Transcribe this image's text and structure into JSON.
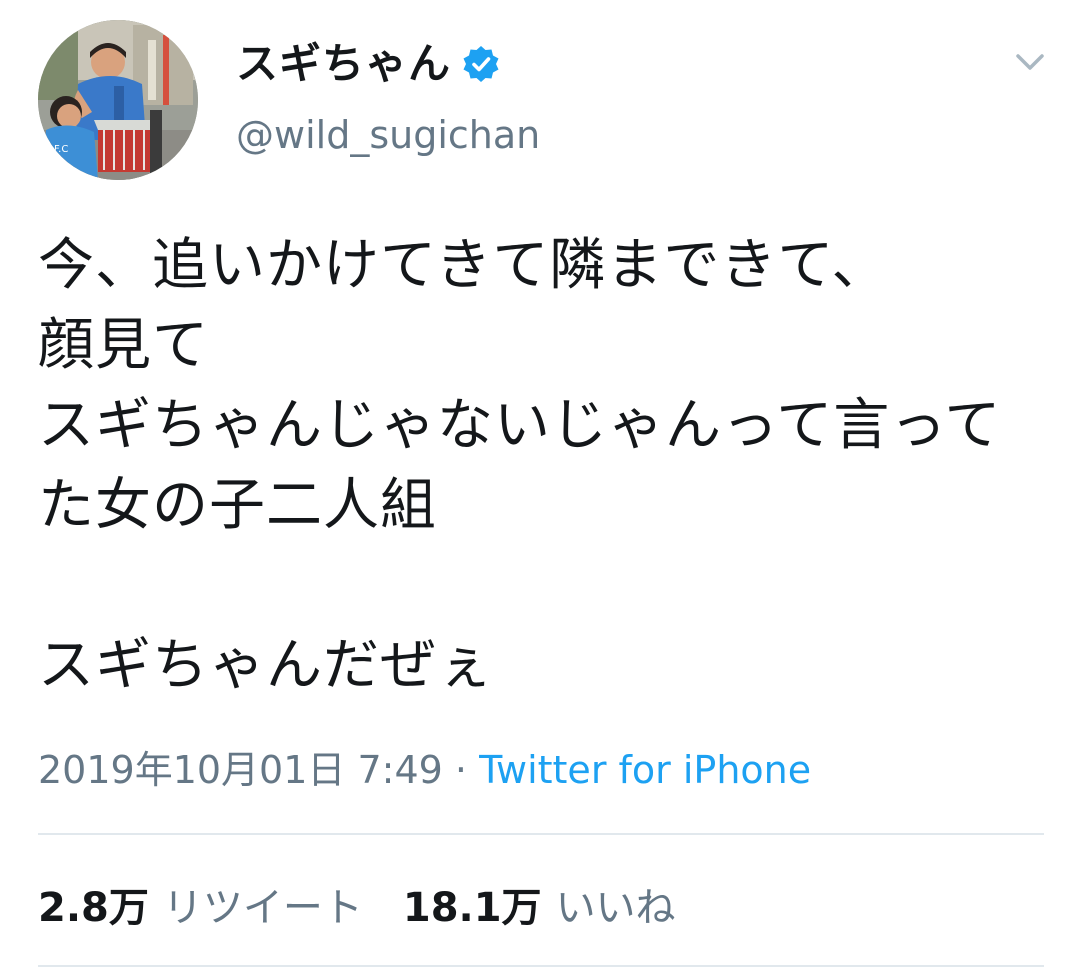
{
  "tweet": {
    "display_name": "スギちゃん",
    "handle": "@wild_sugichan",
    "verified": true,
    "body": "今、追いかけてきて隣まできて、\n顔見て\nスギちゃんじゃないじゃんって言ってた女の子二人組\n\nスギちゃんだぜぇ",
    "timestamp": "2019年10月01日 7:49",
    "separator": " · ",
    "source": "Twitter for iPhone",
    "stats": {
      "retweets_count": "2.8万",
      "retweets_label": "リツイート",
      "likes_count": "18.1万",
      "likes_label": "いいね"
    },
    "icons": {
      "verified": "verified-badge-icon",
      "menu": "chevron-down-icon",
      "avatar": "profile-avatar"
    },
    "colors": {
      "verified": "#1da1f2",
      "link": "#1da1f2",
      "secondary_text": "#657786",
      "primary_text": "#14171a",
      "divider": "#e1e8ed"
    }
  }
}
